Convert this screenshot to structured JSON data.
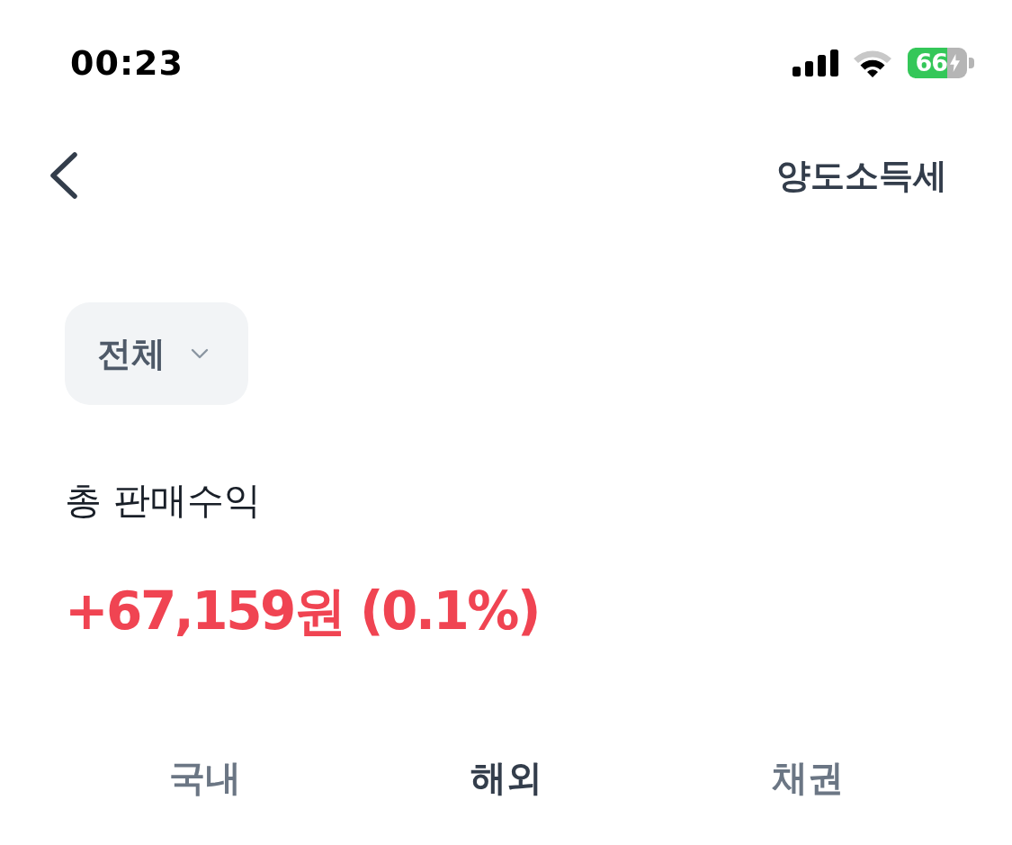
{
  "status_bar": {
    "time": "00:23",
    "battery": "66"
  },
  "header": {
    "title": "양도소득세"
  },
  "filter": {
    "label": "전체"
  },
  "summary": {
    "label": "총 판매수익",
    "value": "+67,159원 (0.1%)"
  },
  "tabs": [
    {
      "label": "국내",
      "selected": false
    },
    {
      "label": "해외",
      "selected": true
    },
    {
      "label": "채권",
      "selected": false
    }
  ]
}
